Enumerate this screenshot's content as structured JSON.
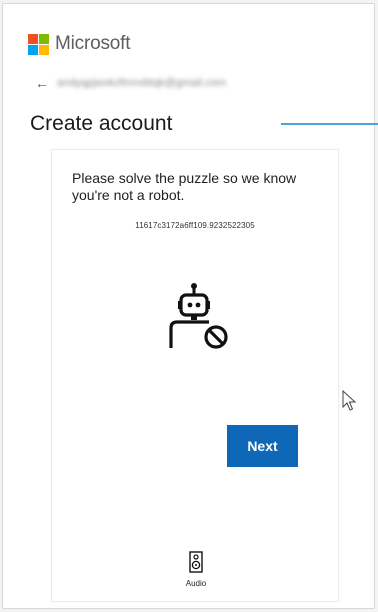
{
  "brand": {
    "name": "Microsoft",
    "logo_colors": [
      "#f25022",
      "#7fba00",
      "#00a4ef",
      "#ffb900"
    ]
  },
  "header": {
    "back_icon": "back-arrow-icon",
    "email": "andyqpjwxkzfmnvbtqk@gmail.com"
  },
  "page": {
    "title": "Create account",
    "accent_color": "#4aa3df"
  },
  "puzzle": {
    "instructions": "Please solve the puzzle so we know you're not a robot.",
    "session_id": "11617c3172a6ff109.9232522305",
    "illustration_icon": "robot-blocked-icon",
    "next_label": "Next",
    "next_color": "#0f67b8",
    "audio_icon": "speaker-icon",
    "audio_label": "Audio"
  }
}
